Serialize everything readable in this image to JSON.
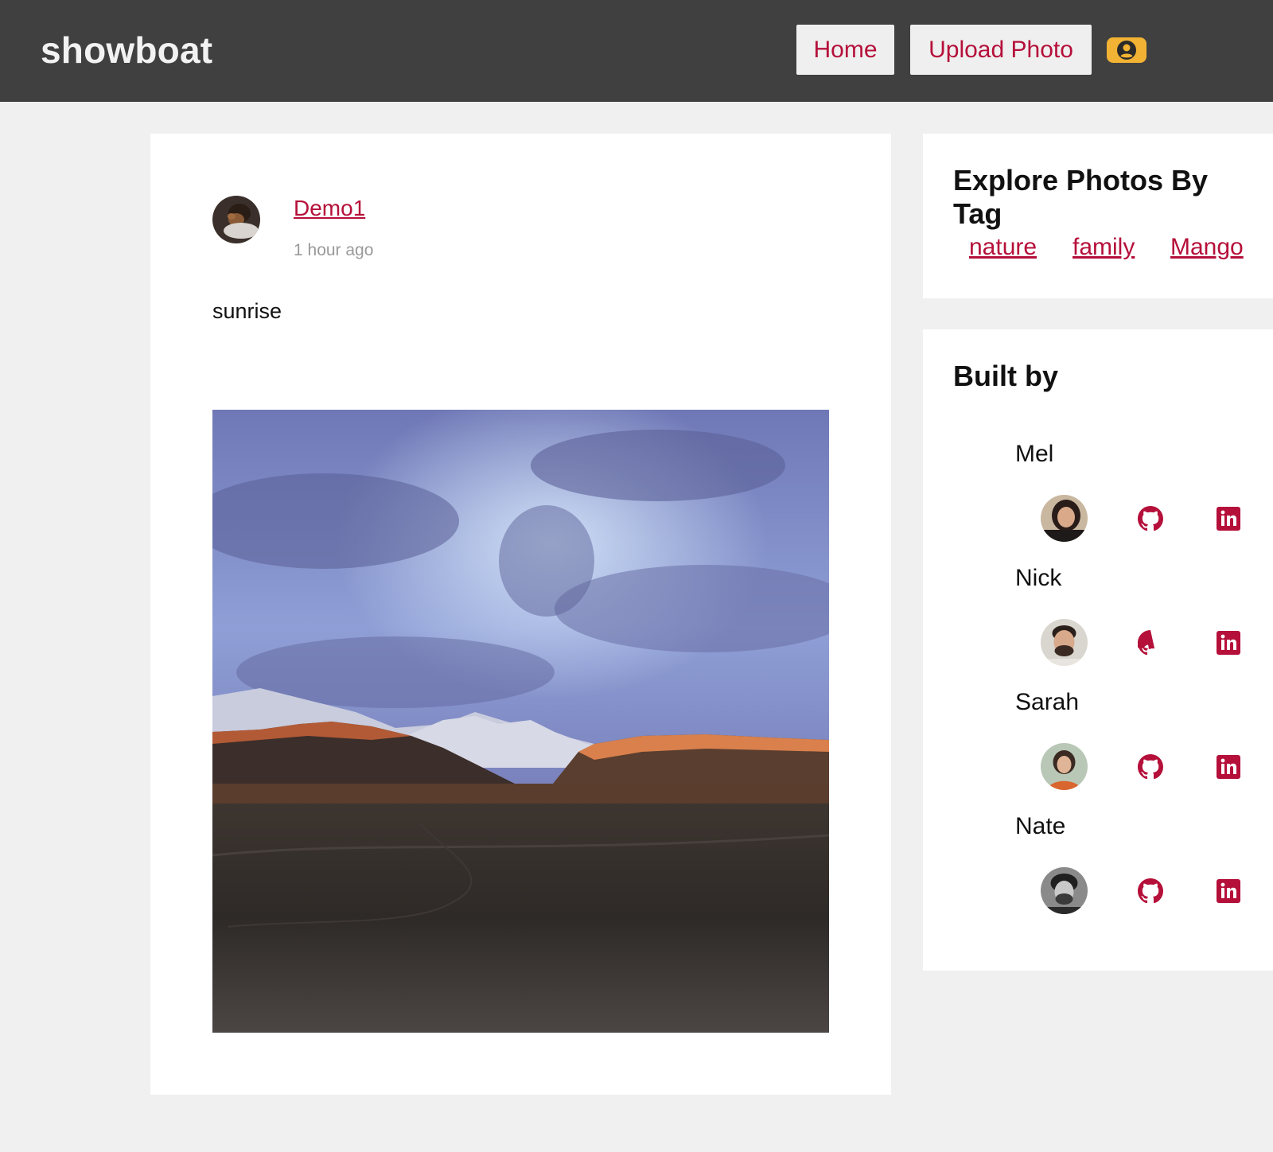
{
  "app": {
    "logo": "showboat"
  },
  "nav": {
    "home_label": "Home",
    "upload_label": "Upload Photo"
  },
  "post": {
    "author": "Demo1",
    "time": "1 hour ago",
    "caption": "sunrise"
  },
  "tags": {
    "title": "Explore Photos By Tag",
    "items": [
      "nature",
      "family",
      "Mango"
    ]
  },
  "built_by": {
    "title": "Built by",
    "members": [
      {
        "name": "Mel"
      },
      {
        "name": "Nick"
      },
      {
        "name": "Sarah"
      },
      {
        "name": "Nate"
      }
    ]
  },
  "colors": {
    "accent": "#b5103a",
    "header_bg": "#404040",
    "page_bg": "#f0f0f0",
    "profile_button": "#f2b233"
  },
  "icons": [
    "user-circle-icon",
    "github-icon",
    "linkedin-icon"
  ]
}
